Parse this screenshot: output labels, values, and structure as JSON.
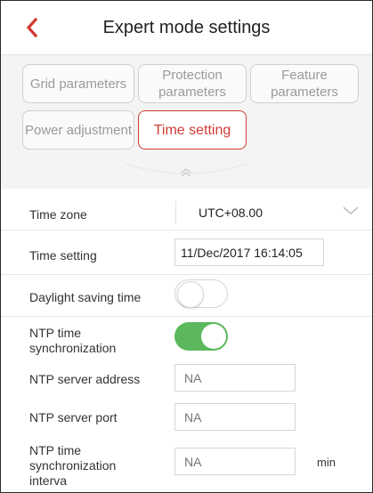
{
  "header": {
    "title": "Expert mode settings",
    "back_icon": "chevron-left-icon",
    "accent_color": "#d03a33"
  },
  "tabs": [
    {
      "label": "Grid parameters",
      "active": false
    },
    {
      "label": "Protection parameters",
      "active": false
    },
    {
      "label": "Feature parameters",
      "active": false
    },
    {
      "label": "Power adjustment",
      "active": false
    },
    {
      "label": "Time setting",
      "active": true
    }
  ],
  "collapse_icon": "double-chevron-up-icon",
  "form": {
    "time_zone": {
      "label": "Time zone",
      "value": "UTC+08.00",
      "icon": "chevron-down-icon"
    },
    "time_setting": {
      "label": "Time setting",
      "value": "11/Dec/2017 16:14:05"
    },
    "daylight_saving": {
      "label": "Daylight saving time",
      "enabled": false
    },
    "ntp_sync": {
      "label": "NTP time synchronization",
      "enabled": true,
      "on_color": "#5cb85c"
    },
    "ntp_server_address": {
      "label": "NTP server address",
      "placeholder": "NA"
    },
    "ntp_server_port": {
      "label": "NTP server port",
      "placeholder": "NA"
    },
    "ntp_interval": {
      "label": "NTP time synchronization interva",
      "placeholder": "NA",
      "unit": "min"
    }
  }
}
